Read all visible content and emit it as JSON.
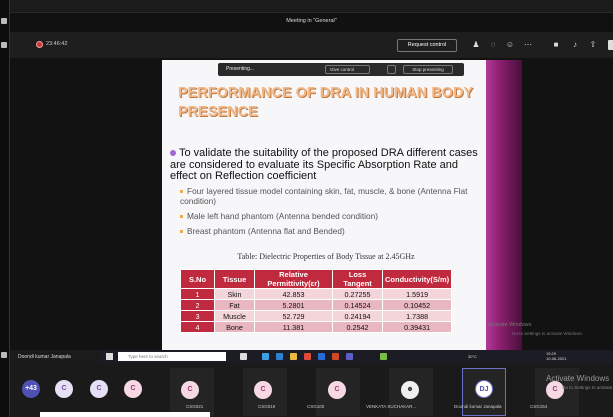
{
  "window": {
    "title": "Meeting in \"General\""
  },
  "controls": {
    "timer": "23:46:42",
    "request_control": "Request control",
    "icons": [
      "people-icon",
      "chat-icon",
      "reactions-icon",
      "more-icon",
      "camera-icon",
      "mic-icon",
      "share-icon"
    ]
  },
  "presenting_bar": {
    "label": "Presenting...",
    "give_control": "Give control",
    "stop": "Stop presenting"
  },
  "slide": {
    "title": "PERFORMANCE OF DRA IN HUMAN BODY PRESENCE",
    "bullet": "To validate the suitability of the proposed DRA different cases are considered to evaluate its Specific Absorption Rate and effect on Reflection coefficient",
    "sub_bullets": [
      "Four layered tissue model containing skin, fat, muscle, & bone (Antenna Flat condition)",
      "Male left hand phantom (Antenna bended condition)",
      "Breast phantom (Antenna flat and Bended)"
    ],
    "caption": "Table: Dielectric Properties of Body Tissue at 2.45GHz",
    "table": {
      "headers": [
        "S.No",
        "Tissue",
        "Relative Permittivity(εr)",
        "Loss Tangent",
        "Conductivity(S/m)"
      ],
      "rows": [
        [
          "1",
          "Skin",
          "42.853",
          "0.27255",
          "1.5919"
        ],
        [
          "2",
          "Fat",
          "5.2801",
          "0.14524",
          "0.10452"
        ],
        [
          "3",
          "Muscle",
          "52.729",
          "0.24194",
          "1.7388"
        ],
        [
          "4",
          "Bone",
          "11.381",
          "0.2542",
          "0.39431"
        ]
      ]
    },
    "watermark": "Activate Windows",
    "watermark_sub": "Go to Settings to activate Windows."
  },
  "taskbar": {
    "presenter": "Doondi kumar Janapala",
    "search_placeholder": "Type here to search",
    "tray_temp": "30°C",
    "clock_time": "15:29",
    "clock_date": "10-06-2021"
  },
  "participants": {
    "overflow": "+43",
    "tiles": [
      {
        "initial": "C",
        "name": "CSG021"
      },
      {
        "initial": "C",
        "name": "CSG019"
      },
      {
        "initial": "C",
        "name": "CSG100"
      },
      {
        "initial": "",
        "name": "VENKATA SUCHAKAR..."
      },
      {
        "initial": "DJ",
        "name": "Doondi kumar Janapala"
      },
      {
        "initial": "C",
        "name": "CSG154"
      }
    ],
    "activate": "Activate Windows",
    "activate_sub": "Go to Settings to activate"
  }
}
